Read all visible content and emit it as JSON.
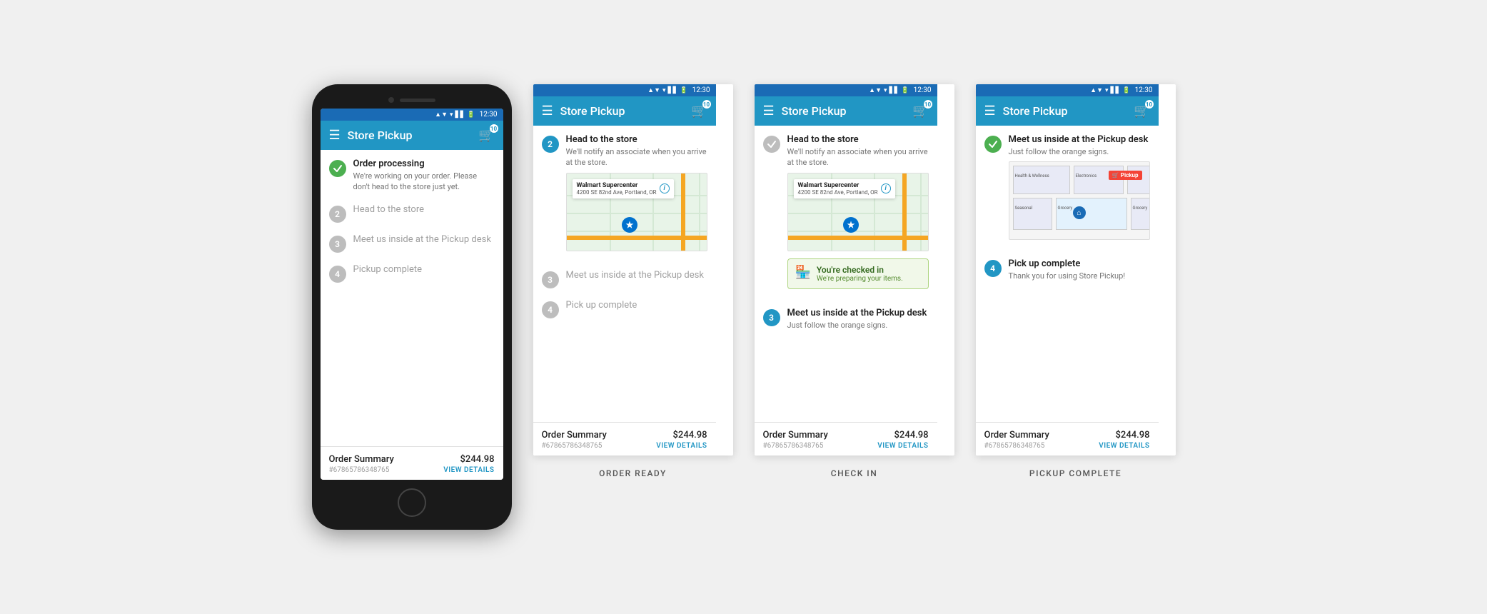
{
  "screens": [
    {
      "id": "screen1",
      "type": "phone",
      "label": null,
      "statusBar": {
        "time": "12:30"
      },
      "appBar": {
        "title": "Store Pickup",
        "cartCount": "10"
      },
      "steps": [
        {
          "num": "✓",
          "state": "active-green",
          "title": "Order processing",
          "desc": "We're working on your order. Please don't head to the store just yet.",
          "hasMap": false,
          "hasCheckin": false,
          "hasFloorplan": false
        },
        {
          "num": "2",
          "state": "inactive",
          "title": "Head to the store",
          "desc": "",
          "hasMap": false,
          "hasCheckin": false,
          "hasFloorplan": false
        },
        {
          "num": "3",
          "state": "inactive",
          "title": "Meet us inside at the Pickup desk",
          "desc": "",
          "hasMap": false,
          "hasCheckin": false,
          "hasFloorplan": false
        },
        {
          "num": "4",
          "state": "inactive",
          "title": "Pickup complete",
          "desc": "",
          "hasMap": false,
          "hasCheckin": false,
          "hasFloorplan": false
        }
      ],
      "orderSummary": {
        "label": "Order Summary",
        "price": "$244.98",
        "number": "#67865786348765",
        "viewDetails": "VIEW DETAILS"
      }
    },
    {
      "id": "screen2",
      "type": "naked",
      "label": "ORDER READY",
      "statusBar": {
        "time": "12:30"
      },
      "appBar": {
        "title": "Store Pickup",
        "cartCount": "10"
      },
      "steps": [
        {
          "num": "2",
          "state": "active-blue",
          "title": "Head to the store",
          "desc": "We'll notify an associate when you arrive at the store.",
          "hasMap": true,
          "hasCheckin": false,
          "hasFloorplan": false
        },
        {
          "num": "3",
          "state": "inactive",
          "title": "Meet us inside at the Pickup desk",
          "desc": "",
          "hasMap": false,
          "hasCheckin": false,
          "hasFloorplan": false
        },
        {
          "num": "4",
          "state": "inactive",
          "title": "Pick up complete",
          "desc": "",
          "hasMap": false,
          "hasCheckin": false,
          "hasFloorplan": false
        }
      ],
      "orderSummary": {
        "label": "Order Summary",
        "price": "$244.98",
        "number": "#67865786348765",
        "viewDetails": "VIEW DETAILS"
      }
    },
    {
      "id": "screen3",
      "type": "naked",
      "label": "CHECK IN",
      "statusBar": {
        "time": "12:30"
      },
      "appBar": {
        "title": "Store Pickup",
        "cartCount": "10"
      },
      "steps": [
        {
          "num": "✓",
          "state": "active-green-dim",
          "title": "Head to the store",
          "desc": "We'll notify an associate when you arrive at the store.",
          "hasMap": true,
          "hasCheckin": true,
          "hasFloorplan": false
        },
        {
          "num": "3",
          "state": "active-blue",
          "title": "Meet us inside at the Pickup desk",
          "desc": "Just follow the orange signs.",
          "hasMap": false,
          "hasCheckin": false,
          "hasFloorplan": false
        }
      ],
      "orderSummary": {
        "label": "Order Summary",
        "price": "$244.98",
        "number": "#67865786348765",
        "viewDetails": "VIEW DETAILS"
      }
    },
    {
      "id": "screen4",
      "type": "naked",
      "label": "PICKUP COMPLETE",
      "statusBar": {
        "time": "12:30"
      },
      "appBar": {
        "title": "Store Pickup",
        "cartCount": "10"
      },
      "steps": [
        {
          "num": "✓",
          "state": "active-green",
          "title": "Meet us inside at the Pickup desk",
          "desc": "Just follow the orange signs.",
          "hasMap": false,
          "hasCheckin": false,
          "hasFloorplan": true
        },
        {
          "num": "4",
          "state": "active-blue",
          "title": "Pick up complete",
          "desc": "Thank you for using Store Pickup!",
          "hasMap": false,
          "hasCheckin": false,
          "hasFloorplan": false
        }
      ],
      "orderSummary": {
        "label": "Order Summary",
        "price": "$244.98",
        "number": "#67865786348765",
        "viewDetails": "VIEW DETAILS"
      }
    }
  ],
  "map": {
    "storeName": "Walmart Supercenter",
    "storeAddress": "4200 SE 82nd Ave, Portland, OR"
  },
  "checkin": {
    "title": "You're checked in",
    "desc": "We're preparing your items."
  },
  "pickup": {
    "badgeText": "🛒 Pickup"
  }
}
